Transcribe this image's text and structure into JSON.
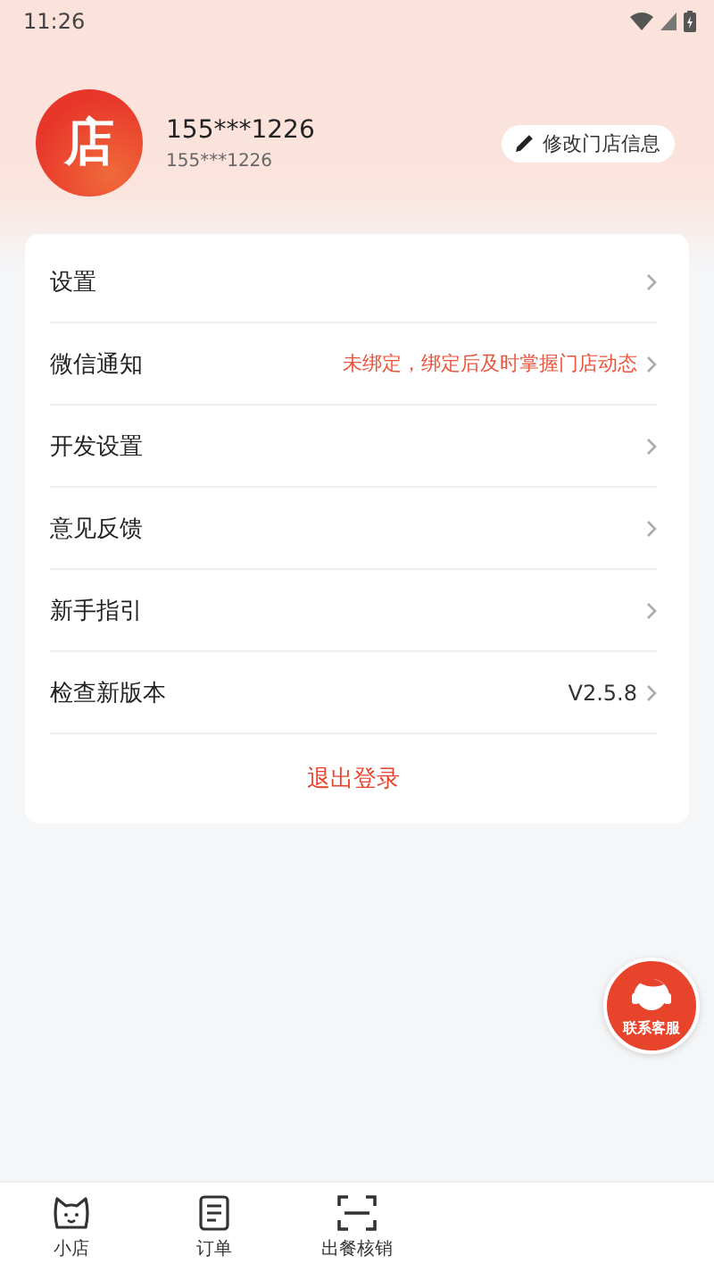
{
  "status_bar": {
    "time": "11:26"
  },
  "profile": {
    "avatar_text": "店",
    "name": "155***1226",
    "phone": "155***1226",
    "edit_button": "修改门店信息"
  },
  "menu": [
    {
      "label": "设置"
    },
    {
      "label": "微信通知",
      "value": "未绑定，绑定后及时掌握门店动态",
      "kind": "warning"
    },
    {
      "label": "开发设置"
    },
    {
      "label": "意见反馈"
    },
    {
      "label": "新手指引"
    },
    {
      "label": "检查新版本",
      "value": "V2.5.8",
      "kind": "plain"
    }
  ],
  "logout_button": "退出登录",
  "service_button": "联系客服",
  "tabs": [
    {
      "label": "小店",
      "kind": "cat",
      "selected": false
    },
    {
      "label": "订单",
      "kind": "doc",
      "selected": false
    },
    {
      "label": "出餐核销",
      "kind": "scan",
      "selected": false
    }
  ]
}
